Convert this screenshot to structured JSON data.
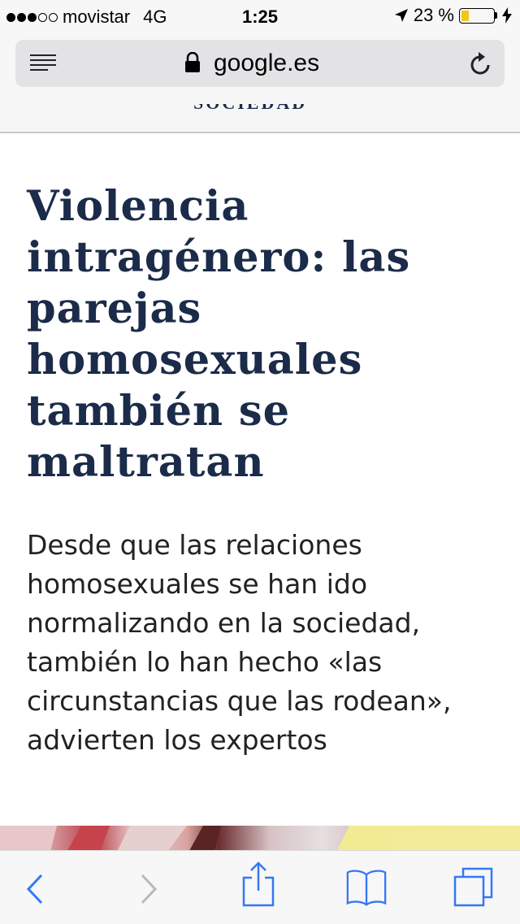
{
  "status_bar": {
    "signal_dots_filled": 3,
    "signal_dots_total": 5,
    "carrier": "movistar",
    "network": "4G",
    "time": "1:25",
    "battery_percent": "23 %",
    "battery_level": 0.23,
    "icons": [
      "location-arrow-icon",
      "battery-icon",
      "charging-bolt-icon"
    ]
  },
  "address_bar": {
    "url": "google.es",
    "icons": [
      "reader-mode-icon",
      "lock-icon",
      "reload-icon"
    ]
  },
  "article": {
    "section": "SOCIEDAD",
    "headline": "Violencia intragénero: las parejas homosexuales también se maltratan",
    "summary": "Desde que las relaciones homosexuales se han ido normalizando en la sociedad, también lo han hecho «las circunstancias que las rodean», advierten los expertos"
  },
  "colors": {
    "headline": "#1b2b49",
    "toolbar_tint": "#3478f6",
    "battery_fill": "#f5c518"
  },
  "toolbar": {
    "icons": [
      "back-icon",
      "forward-icon",
      "share-icon",
      "bookmarks-icon",
      "tabs-icon"
    ]
  }
}
